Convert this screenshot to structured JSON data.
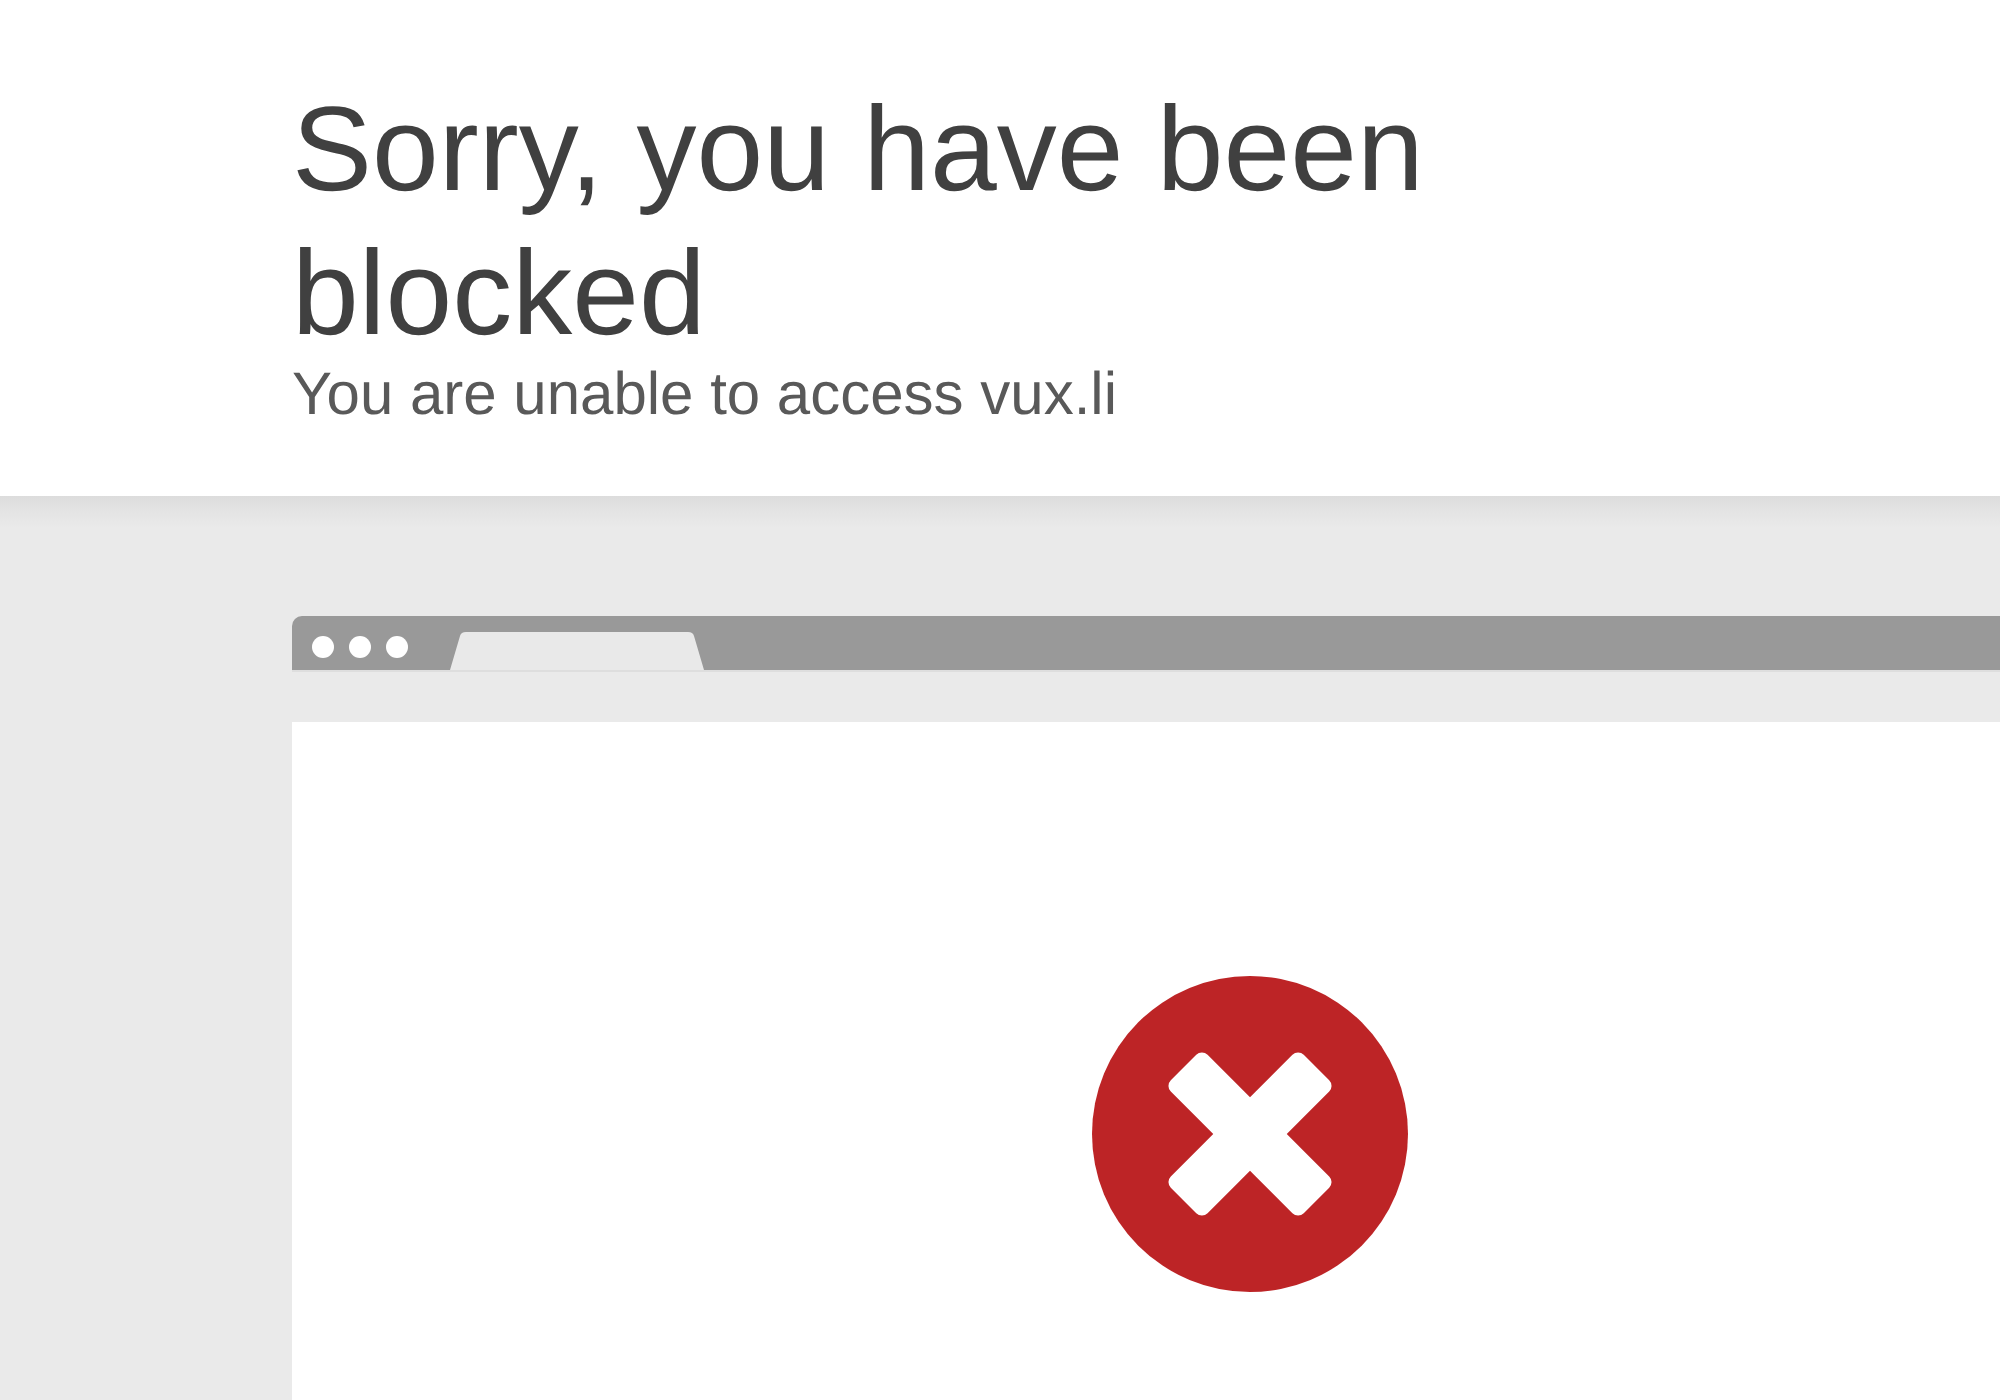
{
  "header": {
    "title": "Sorry, you have been blocked",
    "subtitle": "You are unable to access vux.li"
  }
}
